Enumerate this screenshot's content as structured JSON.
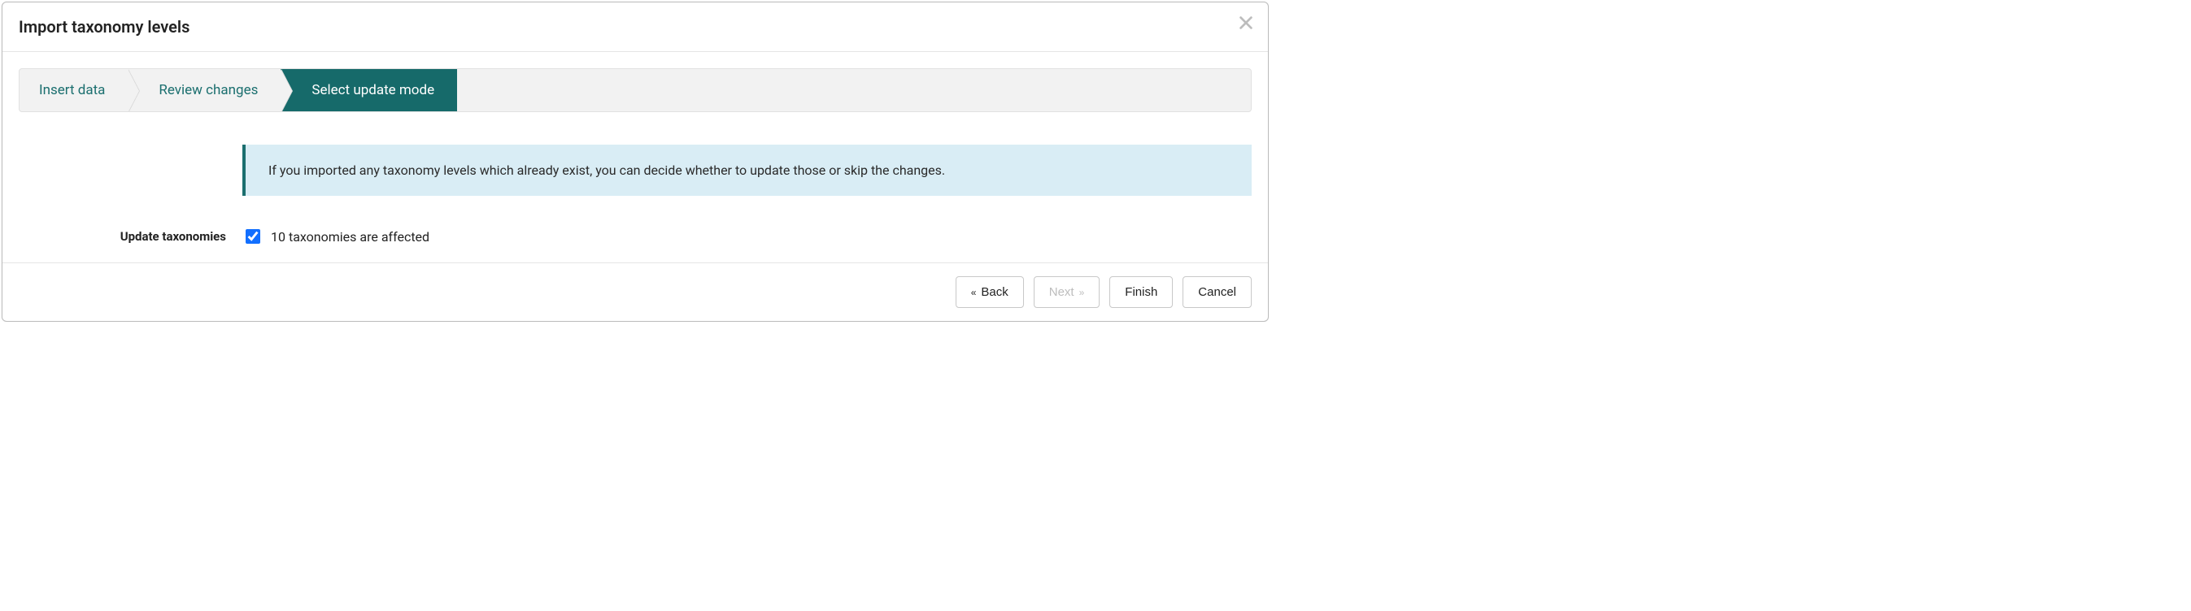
{
  "modal": {
    "title": "Import taxonomy levels"
  },
  "wizard": {
    "steps": [
      {
        "label": "Insert data",
        "active": false
      },
      {
        "label": "Review changes",
        "active": false
      },
      {
        "label": "Select update mode",
        "active": true
      }
    ]
  },
  "info": {
    "message": "If you imported any taxonomy levels which already exist, you can decide whether to update those or skip the changes."
  },
  "form": {
    "update_label": "Update taxonomies",
    "affected_text": "10 taxonomies are affected",
    "checked": true
  },
  "footer": {
    "back": "Back",
    "next": "Next",
    "finish": "Finish",
    "cancel": "Cancel",
    "next_disabled": true
  }
}
